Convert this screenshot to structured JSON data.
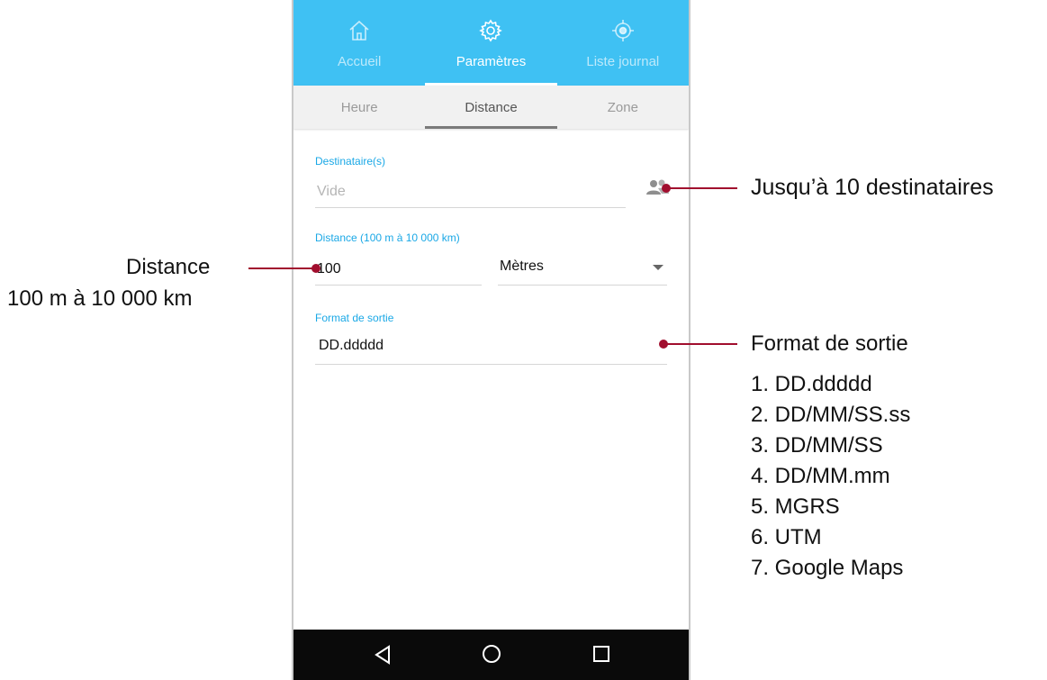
{
  "top_tabs": [
    {
      "label": "Accueil",
      "icon": "home-icon"
    },
    {
      "label": "Paramètres",
      "icon": "gear-icon"
    },
    {
      "label": "Liste journal",
      "icon": "target-icon"
    }
  ],
  "sub_tabs": [
    {
      "label": "Heure"
    },
    {
      "label": "Distance"
    },
    {
      "label": "Zone"
    }
  ],
  "form": {
    "recipients": {
      "label": "Destinataire(s)",
      "placeholder": "Vide",
      "icon": "contacts-icon"
    },
    "distance": {
      "label": "Distance (100 m à 10 000 km)",
      "value": "100",
      "unit": "Mètres"
    },
    "output_format": {
      "label": "Format de sortie",
      "value": "DD.ddddd"
    }
  },
  "annotations": {
    "recipients_note": "Jusqu’à 10 destinataires",
    "distance_title": "Distance",
    "distance_range": "100 m à 10 000 km",
    "format_title": "Format de sortie",
    "format_options": [
      "1. DD.ddddd",
      "2. DD/MM/SS.ss",
      "3. DD/MM/SS",
      "4. DD/MM.mm",
      "5. MGRS",
      "6. UTM",
      "7. Google Maps"
    ]
  },
  "colors": {
    "accent": "#3fc1f3",
    "callout": "#a10e2e",
    "field_label": "#1aa8e6"
  },
  "system_nav": [
    "back-icon",
    "home-circle-icon",
    "recents-icon"
  ]
}
